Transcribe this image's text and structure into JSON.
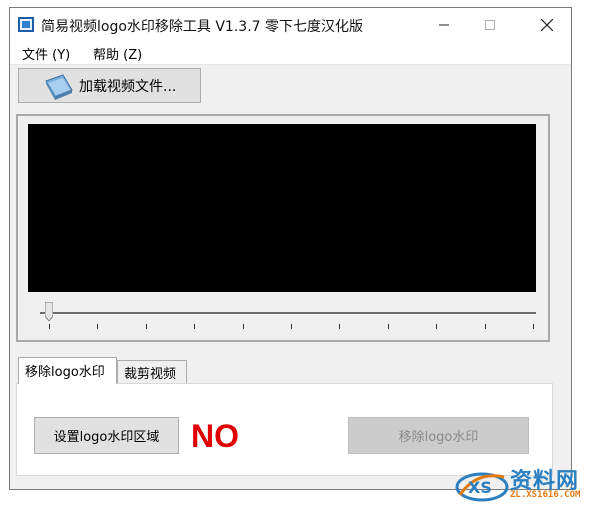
{
  "window": {
    "title": "简易视频logo水印移除工具 V1.3.7 零下七度汉化版",
    "controls": [
      "minimize-icon",
      "maximize-icon",
      "close-icon"
    ]
  },
  "menu": [
    {
      "label": "文件 (Y)"
    },
    {
      "label": "帮助 (Z)"
    }
  ],
  "toolbar": {
    "load_label": "加载视频文件..."
  },
  "player": {
    "position": 0,
    "tick_count": 11
  },
  "tabs": [
    {
      "label": "移除logo水印",
      "active": true
    },
    {
      "label": "裁剪视频",
      "active": false
    }
  ],
  "panel": {
    "set_area_label": "设置logo水印区域",
    "status_text": "NO",
    "status_color": "#e00000",
    "remove_label": "移除logo水印",
    "remove_enabled": false
  },
  "watermark": {
    "logo_text": "XS",
    "main": "资料网",
    "sub": "ZL.XS1616.COM"
  }
}
